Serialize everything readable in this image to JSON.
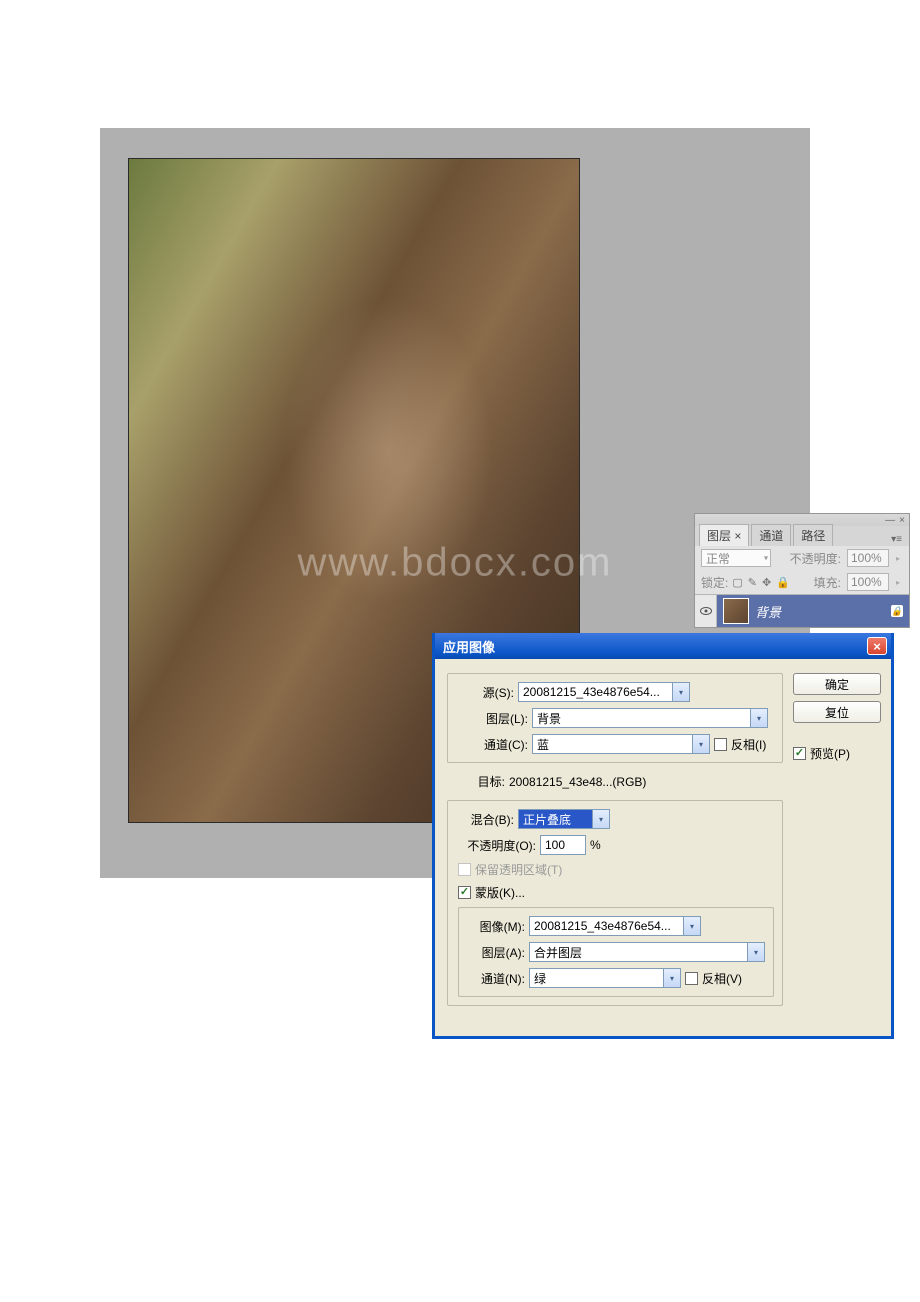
{
  "watermark": "www.bdocx.com",
  "canvas": {},
  "layers_panel": {
    "tabs": {
      "layers": "图层 ×",
      "channels": "通道",
      "paths": "路径"
    },
    "blend_mode": "正常",
    "opacity_label": "不透明度:",
    "opacity_value": "100%",
    "lock_label": "锁定:",
    "fill_label": "填充:",
    "fill_value": "100%",
    "layer": {
      "name": "背景"
    },
    "window_controls": {
      "minimize": "—",
      "close": "×",
      "menu": "▾≡"
    }
  },
  "dialog": {
    "title": "应用图像",
    "close": "×",
    "source": {
      "label": "源(S):",
      "value": "20081215_43e4876e54...",
      "layer_label": "图层(L):",
      "layer_value": "背景",
      "channel_label": "通道(C):",
      "channel_value": "蓝",
      "invert_label": "反相(I)",
      "invert_checked": false
    },
    "target": {
      "label": "目标:",
      "value": "20081215_43e48...(RGB)"
    },
    "blending": {
      "label": "混合(B):",
      "value": "正片叠底",
      "opacity_label": "不透明度(O):",
      "opacity_value": "100",
      "opacity_suffix": "%",
      "preserve_trans_label": "保留透明区域(T)",
      "preserve_trans_enabled": false,
      "mask_label": "蒙版(K)...",
      "mask_checked": true
    },
    "mask": {
      "image_label": "图像(M):",
      "image_value": "20081215_43e4876e54...",
      "layer_label": "图层(A):",
      "layer_value": "合并图层",
      "channel_label": "通道(N):",
      "channel_value": "绿",
      "invert_label": "反相(V)",
      "invert_checked": false
    },
    "buttons": {
      "ok": "确定",
      "reset": "复位",
      "preview": "预览(P)"
    },
    "preview_checked": true
  }
}
